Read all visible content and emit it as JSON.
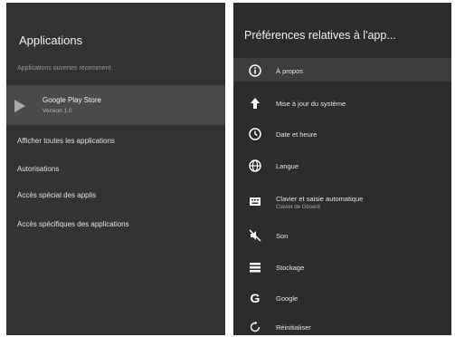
{
  "left": {
    "title": "Applications",
    "section": "Applications ouvertes récemment",
    "selected_app": {
      "name": "Google Play Store",
      "version": "Version 1.0"
    },
    "items": [
      "Afficher toutes les applications",
      "Autorisations",
      "Accès spécial des applis",
      "Accès spécifiques des applications"
    ]
  },
  "right": {
    "title": "Préférences relatives à l'app...",
    "items": [
      {
        "icon": "info-icon",
        "label": "À propos"
      },
      {
        "icon": "system-update-icon",
        "label": "Mise à jour du système"
      },
      {
        "icon": "clock-icon",
        "label": "Date et heure"
      },
      {
        "icon": "globe-icon",
        "label": "Langue"
      },
      {
        "icon": "keyboard-icon",
        "label": "Clavier et saisie automatique",
        "sub": "Clavier de Gboard"
      },
      {
        "icon": "sound-off-icon",
        "label": "Son"
      },
      {
        "icon": "storage-icon",
        "label": "Stockage"
      },
      {
        "icon": "google-icon",
        "label": "Google"
      },
      {
        "icon": "reset-icon",
        "label": "Réinitialiser"
      }
    ]
  },
  "colors": {
    "panel": "#333333",
    "selected": "#4a4a4a",
    "background": "#ffffff"
  }
}
